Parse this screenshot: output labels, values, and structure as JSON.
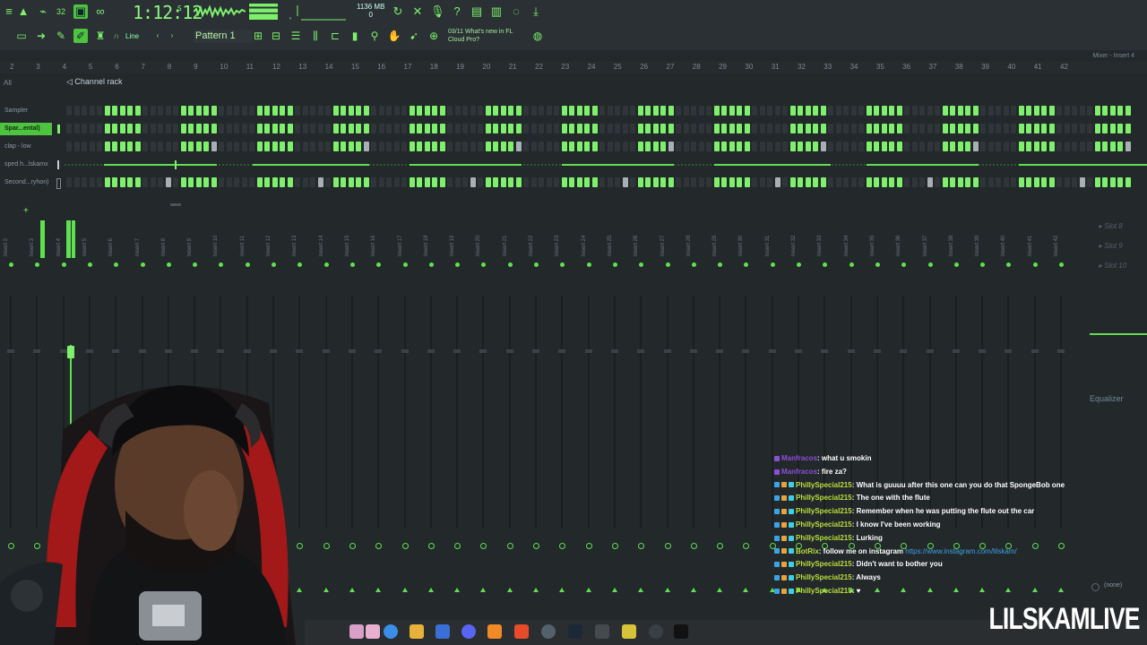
{
  "toolbar": {
    "time_main": "1:12:12",
    "time_small": "S",
    "memory_top": "1136 MB",
    "memory_bottom": "0",
    "pattern": "Pattern 1",
    "draw_mode": "Line",
    "hint_line1": "03/11  What's new in FL",
    "hint_line2": "Cloud Pro?"
  },
  "mixer_header": "Mixer - Insert 4",
  "ruler": [
    "2",
    "3",
    "4",
    "5",
    "6",
    "7",
    "8",
    "9",
    "10",
    "11",
    "12",
    "13",
    "14",
    "15",
    "16",
    "17",
    "18",
    "19",
    "20",
    "21",
    "22",
    "23",
    "24",
    "25",
    "26",
    "27",
    "28",
    "29",
    "30",
    "31",
    "32",
    "33",
    "34",
    "35",
    "36",
    "37",
    "38",
    "39",
    "40",
    "41",
    "42"
  ],
  "rack": {
    "filter": "All",
    "title": "Channel rack",
    "channels": [
      {
        "name": "Sampler",
        "selected": false
      },
      {
        "name": "Spar...ental)",
        "selected": true
      },
      {
        "name": "clap - low",
        "selected": false
      },
      {
        "name": "sped h...lskamx",
        "selected": false
      },
      {
        "name": "Second...ryhon)",
        "selected": false
      }
    ]
  },
  "mixer": {
    "inserts": [
      "Insert 2",
      "Insert 3",
      "Insert 4",
      "Insert 5",
      "Insert 6",
      "Insert 7",
      "Insert 8",
      "Insert 9",
      "Insert 10",
      "Insert 11",
      "Insert 12",
      "Insert 13",
      "Insert 14",
      "Insert 15",
      "Insert 16",
      "Insert 17",
      "Insert 18",
      "Insert 19",
      "Insert 20",
      "Insert 21",
      "Insert 22",
      "Insert 23",
      "Insert 24",
      "Insert 25",
      "Insert 26",
      "Insert 27",
      "Insert 28",
      "Insert 29",
      "Insert 30",
      "Insert 31",
      "Insert 32",
      "Insert 33",
      "Insert 34",
      "Insert 35",
      "Insert 36",
      "Insert 37",
      "Insert 38",
      "Insert 39",
      "Insert 40",
      "Insert 41",
      "Insert 42"
    ],
    "slots": [
      "Slot 8",
      "Slot 9",
      "Slot 10"
    ],
    "effect": "Equalizer",
    "output": "(none)"
  },
  "chat": [
    {
      "user": "Manfracos",
      "msg": ": what u smokin",
      "role": "mod"
    },
    {
      "user": "Manfracos",
      "msg": ": fire za?",
      "role": "mod"
    },
    {
      "user": "PhillySpecial215",
      "msg": ": What is guuuu after this one can you do that SpongeBob one",
      "role": "user"
    },
    {
      "user": "PhillySpecial215",
      "msg": ": The one with the flute",
      "role": "user"
    },
    {
      "user": "PhillySpecial215",
      "msg": ": Remember when he was putting the flute out the car",
      "role": "user"
    },
    {
      "user": "PhillySpecial215",
      "msg": ": I know I've been working",
      "role": "user"
    },
    {
      "user": "PhillySpecial215",
      "msg": ": Lurking",
      "role": "user"
    },
    {
      "user": "BotRix",
      "msg": ": follow me on instagram",
      "link": "https://www.instagram.com/lilskam/",
      "role": "bot"
    },
    {
      "user": "PhillySpecial215",
      "msg": ": Didn't want to bother you",
      "role": "user"
    },
    {
      "user": "PhillySpecial215",
      "msg": ": Always",
      "role": "user"
    },
    {
      "user": "PhillySpecial215",
      "msg": ": ♥",
      "role": "user"
    }
  ],
  "brand": "LILSKAMLIVE",
  "colors": {
    "accent": "#7ef06c",
    "background": "#23282b",
    "chat_user": "#b9e03a",
    "chat_mod": "#8b4fd6"
  }
}
